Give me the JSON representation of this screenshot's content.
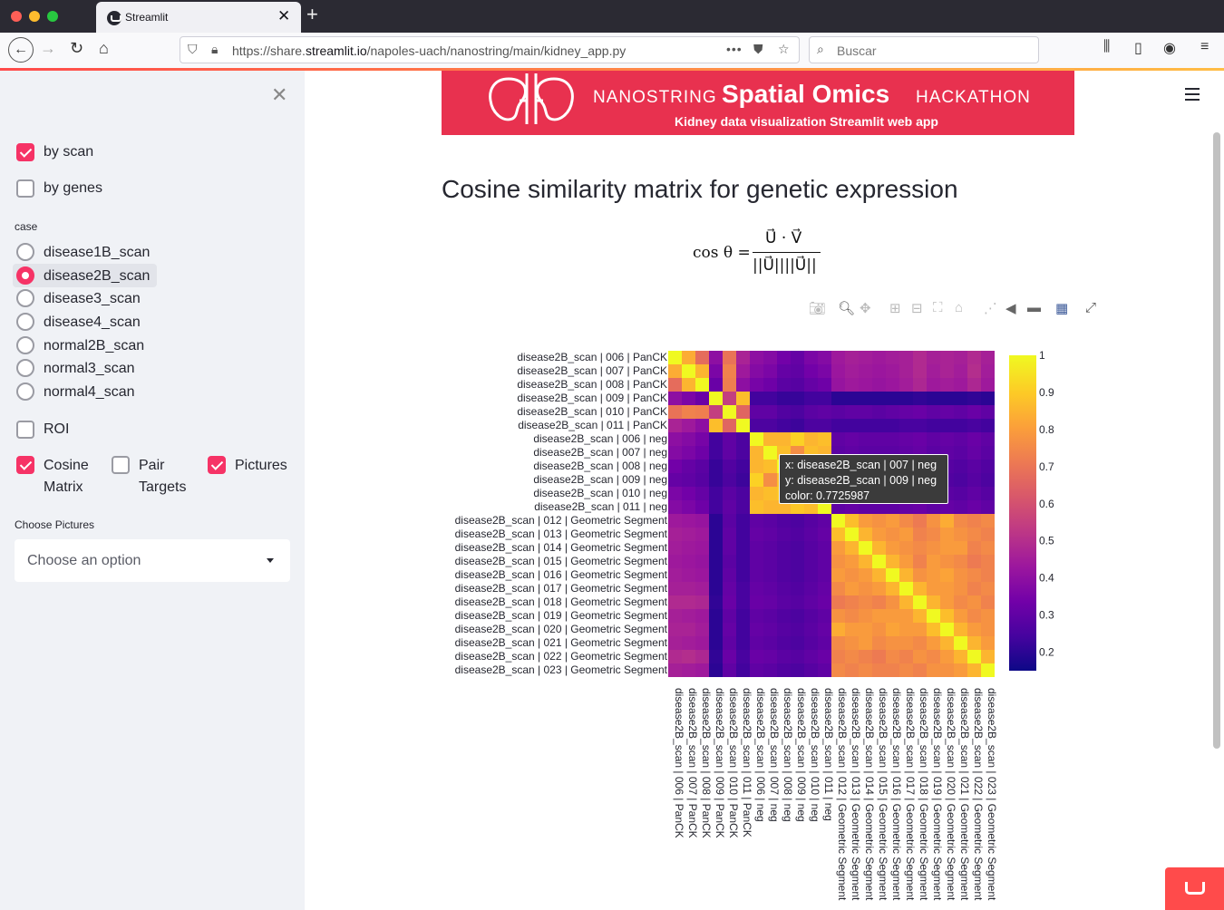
{
  "browser": {
    "tab_title": "Streamlit",
    "url_prefix": "https://share.",
    "url_domain": "streamlit.io",
    "url_path": "/napoles-uach/nanostring/main/kidney_app.py",
    "search_placeholder": "Buscar"
  },
  "sidebar": {
    "by_scan": {
      "label": "by scan",
      "checked": true
    },
    "by_genes": {
      "label": "by genes",
      "checked": false
    },
    "case_label": "case",
    "cases": [
      {
        "label": "disease1B_scan",
        "selected": false
      },
      {
        "label": "disease2B_scan",
        "selected": true
      },
      {
        "label": "disease3_scan",
        "selected": false
      },
      {
        "label": "disease4_scan",
        "selected": false
      },
      {
        "label": "normal2B_scan",
        "selected": false
      },
      {
        "label": "normal3_scan",
        "selected": false
      },
      {
        "label": "normal4_scan",
        "selected": false
      }
    ],
    "roi": {
      "label": "ROI",
      "checked": false
    },
    "cosine": {
      "label1": "Cosine",
      "label2": "Matrix",
      "checked": true
    },
    "pair": {
      "label1": "Pair",
      "label2": "Targets",
      "checked": false
    },
    "pictures": {
      "label": "Pictures",
      "checked": true
    },
    "choose_pictures_label": "Choose Pictures",
    "choose_placeholder": "Choose an option"
  },
  "banner": {
    "left": "NANOSTRING",
    "center": "Spatial Omics",
    "right": "HACKATHON",
    "subtitle": "Kidney data visualization Streamlit web app"
  },
  "main": {
    "title": "Cosine similarity matrix for genetic expression",
    "formula": {
      "lhs": "cos θ =",
      "numerator": "U⃗ · V⃗",
      "denominator": "||U⃗||||U⃗||"
    }
  },
  "tooltip": {
    "x": "x: disease2B_scan | 007 | neg",
    "y": "y: disease2B_scan | 009 | neg",
    "color": "color: 0.7725987"
  },
  "colors": {
    "accent": "#f63366",
    "banner": "#e8314f",
    "plasma": [
      "#0d0887",
      "#46039f",
      "#7201a8",
      "#9c179e",
      "#bd3786",
      "#d8576b",
      "#ed7953",
      "#fb9f3a",
      "#fdca26",
      "#f0f921"
    ]
  },
  "chart_data": {
    "type": "heatmap",
    "labels": [
      "disease2B_scan | 006 | PanCK",
      "disease2B_scan | 007 | PanCK",
      "disease2B_scan | 008 | PanCK",
      "disease2B_scan | 009 | PanCK",
      "disease2B_scan | 010 | PanCK",
      "disease2B_scan | 011 | PanCK",
      "disease2B_scan | 006 | neg",
      "disease2B_scan | 007 | neg",
      "disease2B_scan | 008 | neg",
      "disease2B_scan | 009 | neg",
      "disease2B_scan | 010 | neg",
      "disease2B_scan | 011 | neg",
      "disease2B_scan | 012 | Geometric Segment",
      "disease2B_scan | 013 | Geometric Segment",
      "disease2B_scan | 014 | Geometric Segment",
      "disease2B_scan | 015 | Geometric Segment",
      "disease2B_scan | 016 | Geometric Segment",
      "disease2B_scan | 017 | Geometric Segment",
      "disease2B_scan | 018 | Geometric Segment",
      "disease2B_scan | 019 | Geometric Segment",
      "disease2B_scan | 020 | Geometric Segment",
      "disease2B_scan | 021 | Geometric Segment",
      "disease2B_scan | 022 | Geometric Segment",
      "disease2B_scan | 023 | Geometric Segment"
    ],
    "colorscale": "plasma",
    "zmin": 0.15,
    "zmax": 1.0,
    "colorbar_ticks": [
      "1",
      "0.9",
      "0.8",
      "0.7",
      "0.6",
      "0.5",
      "0.4",
      "0.3",
      "0.2"
    ],
    "z": [
      [
        1.0,
        0.84,
        0.68,
        0.4,
        0.7,
        0.47,
        0.4,
        0.38,
        0.34,
        0.31,
        0.36,
        0.38,
        0.44,
        0.46,
        0.45,
        0.44,
        0.45,
        0.46,
        0.49,
        0.46,
        0.47,
        0.46,
        0.49,
        0.46
      ],
      [
        0.84,
        1.0,
        0.86,
        0.36,
        0.74,
        0.44,
        0.38,
        0.36,
        0.31,
        0.3,
        0.34,
        0.36,
        0.43,
        0.45,
        0.44,
        0.43,
        0.44,
        0.46,
        0.49,
        0.45,
        0.47,
        0.45,
        0.5,
        0.45
      ],
      [
        0.68,
        0.86,
        1.0,
        0.32,
        0.73,
        0.4,
        0.35,
        0.33,
        0.29,
        0.28,
        0.31,
        0.33,
        0.42,
        0.44,
        0.43,
        0.42,
        0.43,
        0.45,
        0.48,
        0.44,
        0.45,
        0.44,
        0.48,
        0.44
      ],
      [
        0.4,
        0.36,
        0.32,
        1.0,
        0.55,
        0.88,
        0.24,
        0.24,
        0.22,
        0.22,
        0.24,
        0.24,
        0.2,
        0.2,
        0.2,
        0.2,
        0.2,
        0.2,
        0.21,
        0.2,
        0.2,
        0.2,
        0.21,
        0.2
      ],
      [
        0.7,
        0.74,
        0.73,
        0.55,
        1.0,
        0.66,
        0.3,
        0.3,
        0.27,
        0.26,
        0.29,
        0.3,
        0.29,
        0.3,
        0.3,
        0.29,
        0.3,
        0.31,
        0.32,
        0.3,
        0.31,
        0.3,
        0.32,
        0.3
      ],
      [
        0.47,
        0.44,
        0.4,
        0.88,
        0.66,
        1.0,
        0.26,
        0.26,
        0.24,
        0.23,
        0.26,
        0.26,
        0.24,
        0.24,
        0.24,
        0.24,
        0.24,
        0.25,
        0.25,
        0.24,
        0.24,
        0.24,
        0.25,
        0.24
      ],
      [
        0.4,
        0.38,
        0.35,
        0.24,
        0.3,
        0.26,
        1.0,
        0.86,
        0.86,
        0.92,
        0.86,
        0.88,
        0.3,
        0.31,
        0.3,
        0.3,
        0.3,
        0.31,
        0.32,
        0.3,
        0.31,
        0.3,
        0.32,
        0.3
      ],
      [
        0.38,
        0.36,
        0.33,
        0.24,
        0.3,
        0.26,
        0.86,
        1.0,
        0.88,
        0.77,
        0.88,
        0.86,
        0.29,
        0.3,
        0.29,
        0.29,
        0.29,
        0.3,
        0.31,
        0.29,
        0.3,
        0.29,
        0.31,
        0.29
      ],
      [
        0.34,
        0.31,
        0.29,
        0.22,
        0.27,
        0.24,
        0.86,
        0.88,
        1.0,
        0.88,
        0.9,
        0.86,
        0.27,
        0.28,
        0.27,
        0.27,
        0.27,
        0.28,
        0.29,
        0.27,
        0.28,
        0.27,
        0.29,
        0.27
      ],
      [
        0.31,
        0.3,
        0.28,
        0.22,
        0.26,
        0.23,
        0.92,
        0.77,
        0.88,
        1.0,
        0.88,
        0.9,
        0.26,
        0.27,
        0.26,
        0.26,
        0.26,
        0.27,
        0.28,
        0.26,
        0.27,
        0.26,
        0.28,
        0.26
      ],
      [
        0.36,
        0.34,
        0.31,
        0.24,
        0.29,
        0.26,
        0.86,
        0.88,
        0.9,
        0.88,
        1.0,
        0.88,
        0.28,
        0.29,
        0.28,
        0.28,
        0.28,
        0.29,
        0.3,
        0.28,
        0.29,
        0.28,
        0.3,
        0.28
      ],
      [
        0.38,
        0.36,
        0.33,
        0.24,
        0.3,
        0.26,
        0.88,
        0.86,
        0.86,
        0.9,
        0.88,
        1.0,
        0.3,
        0.31,
        0.3,
        0.3,
        0.3,
        0.31,
        0.32,
        0.3,
        0.31,
        0.3,
        0.32,
        0.3
      ],
      [
        0.44,
        0.43,
        0.42,
        0.2,
        0.29,
        0.24,
        0.3,
        0.29,
        0.27,
        0.26,
        0.28,
        0.3,
        1.0,
        0.88,
        0.8,
        0.78,
        0.8,
        0.76,
        0.72,
        0.78,
        0.84,
        0.76,
        0.74,
        0.76
      ],
      [
        0.46,
        0.45,
        0.44,
        0.2,
        0.3,
        0.24,
        0.31,
        0.3,
        0.28,
        0.27,
        0.29,
        0.31,
        0.88,
        1.0,
        0.86,
        0.8,
        0.78,
        0.8,
        0.74,
        0.76,
        0.8,
        0.78,
        0.76,
        0.74
      ],
      [
        0.45,
        0.44,
        0.43,
        0.2,
        0.3,
        0.24,
        0.3,
        0.29,
        0.27,
        0.26,
        0.28,
        0.3,
        0.8,
        0.86,
        1.0,
        0.86,
        0.8,
        0.78,
        0.76,
        0.78,
        0.8,
        0.8,
        0.74,
        0.76
      ],
      [
        0.44,
        0.43,
        0.42,
        0.2,
        0.29,
        0.24,
        0.3,
        0.29,
        0.27,
        0.26,
        0.28,
        0.3,
        0.78,
        0.8,
        0.86,
        1.0,
        0.86,
        0.8,
        0.74,
        0.8,
        0.78,
        0.76,
        0.72,
        0.74
      ],
      [
        0.45,
        0.44,
        0.43,
        0.2,
        0.3,
        0.24,
        0.3,
        0.29,
        0.27,
        0.26,
        0.28,
        0.3,
        0.8,
        0.78,
        0.8,
        0.86,
        1.0,
        0.86,
        0.78,
        0.8,
        0.82,
        0.78,
        0.76,
        0.74
      ],
      [
        0.46,
        0.46,
        0.45,
        0.2,
        0.31,
        0.25,
        0.31,
        0.3,
        0.28,
        0.27,
        0.29,
        0.31,
        0.76,
        0.8,
        0.78,
        0.8,
        0.86,
        1.0,
        0.86,
        0.8,
        0.8,
        0.78,
        0.74,
        0.76
      ],
      [
        0.49,
        0.49,
        0.48,
        0.21,
        0.32,
        0.25,
        0.32,
        0.31,
        0.29,
        0.28,
        0.3,
        0.32,
        0.72,
        0.74,
        0.76,
        0.74,
        0.78,
        0.86,
        1.0,
        0.86,
        0.8,
        0.76,
        0.78,
        0.74
      ],
      [
        0.46,
        0.45,
        0.44,
        0.2,
        0.3,
        0.24,
        0.3,
        0.29,
        0.27,
        0.26,
        0.28,
        0.3,
        0.78,
        0.76,
        0.78,
        0.8,
        0.8,
        0.8,
        0.86,
        1.0,
        0.88,
        0.8,
        0.76,
        0.78
      ],
      [
        0.47,
        0.47,
        0.45,
        0.2,
        0.31,
        0.24,
        0.31,
        0.3,
        0.28,
        0.27,
        0.29,
        0.31,
        0.84,
        0.8,
        0.8,
        0.78,
        0.82,
        0.8,
        0.8,
        0.88,
        1.0,
        0.86,
        0.8,
        0.78
      ],
      [
        0.46,
        0.45,
        0.44,
        0.2,
        0.3,
        0.24,
        0.3,
        0.29,
        0.27,
        0.26,
        0.28,
        0.3,
        0.76,
        0.78,
        0.8,
        0.76,
        0.78,
        0.78,
        0.76,
        0.8,
        0.86,
        1.0,
        0.86,
        0.8
      ],
      [
        0.49,
        0.5,
        0.48,
        0.21,
        0.32,
        0.25,
        0.32,
        0.31,
        0.29,
        0.28,
        0.3,
        0.32,
        0.74,
        0.76,
        0.74,
        0.72,
        0.76,
        0.74,
        0.78,
        0.76,
        0.8,
        0.86,
        1.0,
        0.86
      ],
      [
        0.46,
        0.45,
        0.44,
        0.2,
        0.3,
        0.24,
        0.3,
        0.29,
        0.27,
        0.26,
        0.28,
        0.3,
        0.76,
        0.74,
        0.76,
        0.74,
        0.74,
        0.76,
        0.74,
        0.78,
        0.78,
        0.8,
        0.86,
        1.0
      ]
    ]
  }
}
